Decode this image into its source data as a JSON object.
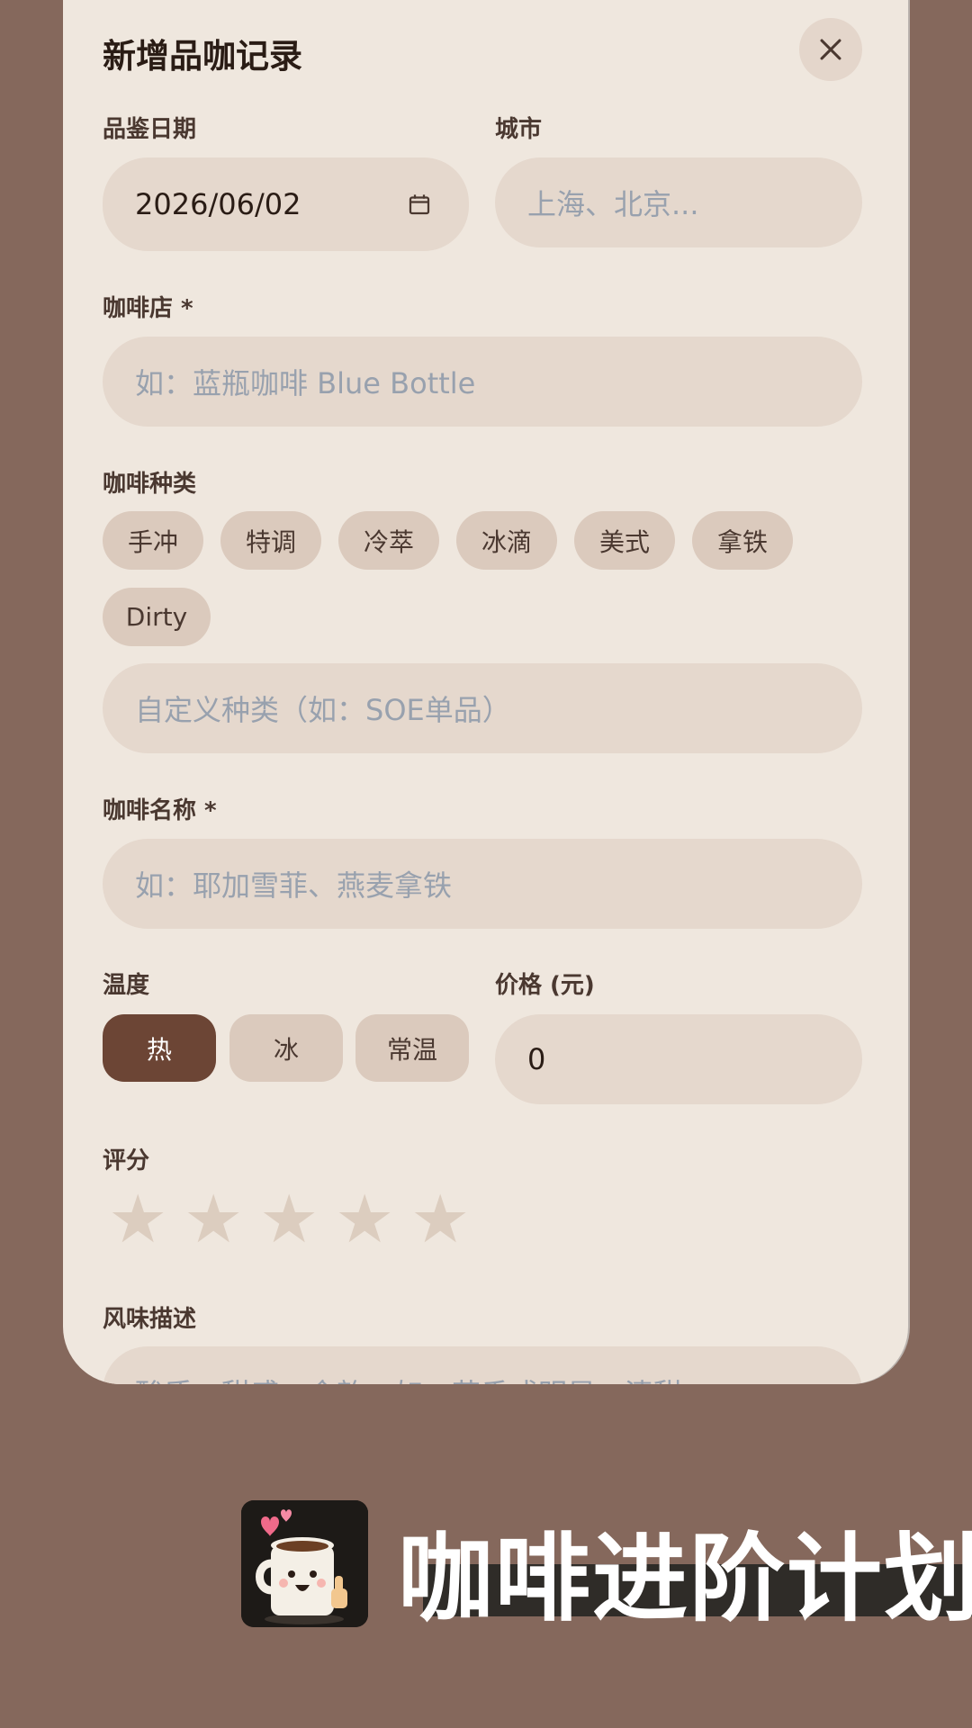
{
  "modal": {
    "title": "新增品咖记录",
    "close_icon": "close-icon"
  },
  "form": {
    "date": {
      "label": "品鉴日期",
      "value": "2026/06/02",
      "icon": "calendar-icon"
    },
    "city": {
      "label": "城市",
      "placeholder": "上海、北京..."
    },
    "shop": {
      "label": "咖啡店 *",
      "placeholder": "如：蓝瓶咖啡 Blue Bottle"
    },
    "type": {
      "label": "咖啡种类",
      "options": [
        "手冲",
        "特调",
        "冷萃",
        "冰滴",
        "美式",
        "拿铁",
        "Dirty"
      ],
      "custom_placeholder": "自定义种类（如：SOE单品）"
    },
    "name": {
      "label": "咖啡名称 *",
      "placeholder": "如：耶加雪菲、燕麦拿铁"
    },
    "temperature": {
      "label": "温度",
      "options": [
        "热",
        "冰",
        "常温"
      ],
      "selected": "热"
    },
    "price": {
      "label": "价格 (元)",
      "value": "0"
    },
    "rating": {
      "label": "评分",
      "max": 5,
      "value": 0,
      "icon": "star-icon"
    },
    "flavor": {
      "label": "风味描述",
      "placeholder": "酸质、甜感、余韵、如：花香或明显、清甜..."
    }
  },
  "brand": {
    "name": "咖啡进阶计划",
    "icon": "coffee-mug-mascot-icon"
  },
  "colors": {
    "background": "#85685c",
    "sheet": "#efe7de",
    "field": "#e5d8cd",
    "chip": "#dbcabd",
    "accent": "#6c4535",
    "star_empty": "#dccdbf",
    "placeholder": "#98a1ae"
  }
}
